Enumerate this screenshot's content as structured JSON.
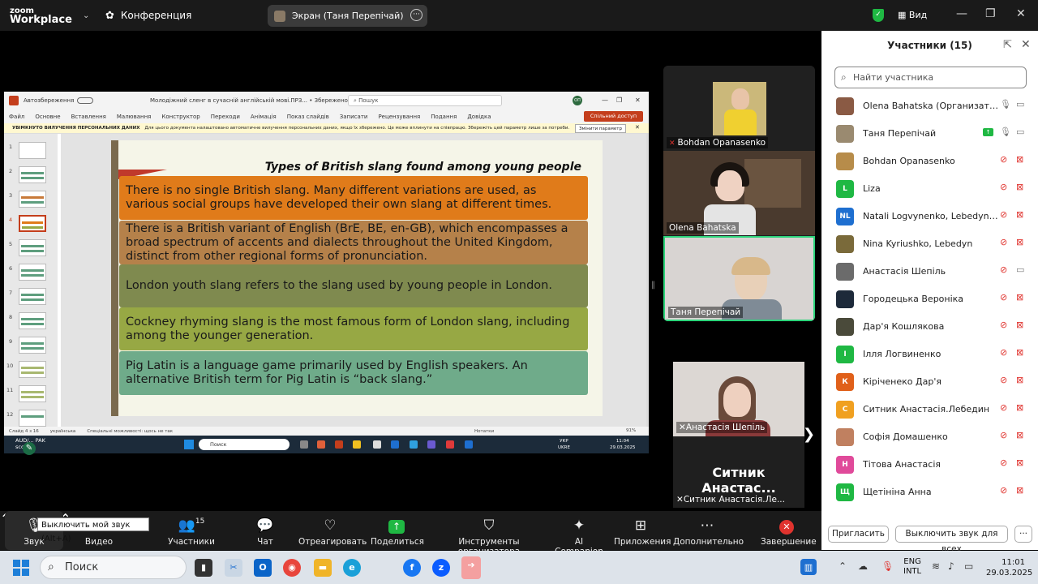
{
  "app": {
    "logo_line1": "zoom",
    "logo_line2": "Workplace",
    "conference_label": "Конференция",
    "share_pill": "Экран (Таня Перепічай)",
    "view_label": "Вид",
    "brand_green": "#1fb843",
    "end_red": "#e0332e"
  },
  "ppt": {
    "autosave": "Автозбереження",
    "filename": "Молодіжний сленг в сучасній англійській мові.ПРЗ... • Збережено у цей ПК",
    "search": "Пошук",
    "user_initials": "ОП",
    "menu": [
      "Файл",
      "Основне",
      "Вставлення",
      "Малювання",
      "Конструктор",
      "Переходи",
      "Анімація",
      "Показ слайдів",
      "Записати",
      "Рецензування",
      "Подання",
      "Довідка"
    ],
    "share_button": "Спільний доступ",
    "notice_bold": "УВІМКНУТО ВИЛУЧЕННЯ ПЕРСОНАЛЬНИХ ДАНИХ",
    "notice_text": "Для цього документа налаштовано автоматичне вилучення персональних даних, якщо їх збережено. Це може вплинути на співпрацю. Збережіть цей параметр лише за потреби.",
    "notice_button": "Змінити параметр",
    "slide_numbers": [
      "1",
      "2",
      "3",
      "4",
      "5",
      "6",
      "7",
      "8",
      "9",
      "10",
      "11",
      "12"
    ],
    "selected_slide": "4",
    "slide": {
      "title": "Types of British slang found among young people",
      "boxes": [
        {
          "text": "There is no single British slang. Many different variations are used, as various social groups have developed their own slang at different times.",
          "color": "#e07b1a"
        },
        {
          "text": "There is a British variant of English (BrE, BE, en-GB), which encompasses a broad spectrum of accents and dialects throughout the United Kingdom, distinct from other regional forms of pronunciation.",
          "color": "#b5814a"
        },
        {
          "text": "London youth slang refers to the slang used by young people in London.",
          "color": "#7f8a4f"
        },
        {
          "text": "Cockney rhyming slang is the most famous form of London slang, including among the younger generation.",
          "color": "#97a844"
        },
        {
          "text": "Pig Latin is a language game primarily used by English speakers. An alternative British term for Pig Latin is “back slang.”",
          "color": "#6fab8a"
        }
      ]
    },
    "status_slide": "Слайд 4 з 16",
    "status_lang": "українська",
    "status_access": "Спеціальні можливості: щось не так",
    "status_notes": "Нотатки",
    "status_zoom": "91%",
    "taskbar_game": "AUD/... PAK",
    "taskbar_game2": "score",
    "taskbar_search": "Поиск",
    "taskbar_lang1": "УКР",
    "taskbar_lang2": "UKRE",
    "taskbar_time": "11:04",
    "taskbar_date": "29.03.2025"
  },
  "gallery": {
    "tiles": [
      {
        "name": "Bohdan Opanasenko",
        "muted": true
      },
      {
        "name": "Olena Bahatska",
        "muted": false
      },
      {
        "name": "Таня Перепічай",
        "muted": false
      }
    ],
    "big_tile": {
      "video_name": "Анастасія Шепіль",
      "display_text": "Ситник  Анастас...",
      "name": "Ситник Анастасія.Ле..."
    }
  },
  "participants": {
    "title": "Участники (15)",
    "search_placeholder": "Найти участника",
    "list": [
      {
        "name": "Olena Bahatska (Организатор, я)",
        "initials": "",
        "color": "#8a5a44",
        "mic": "on",
        "cam": "on",
        "sharing": false
      },
      {
        "name": "Таня Перепічай",
        "initials": "",
        "color": "#9a8a70",
        "mic": "on",
        "cam": "on",
        "sharing": true
      },
      {
        "name": "Bohdan Opanasenko",
        "initials": "",
        "color": "#b78c4a",
        "mic": "off",
        "cam": "off",
        "sharing": false
      },
      {
        "name": "Liza",
        "initials": "L",
        "color": "#1fb843",
        "mic": "off",
        "cam": "off",
        "sharing": false
      },
      {
        "name": "Natali Logvynenko, Lebedyn, Sum...",
        "initials": "NL",
        "color": "#1e6fd0",
        "mic": "off",
        "cam": "off",
        "sharing": false
      },
      {
        "name": "Nina Kyriushko, Lebedyn",
        "initials": "",
        "color": "#7a6a3a",
        "mic": "off",
        "cam": "off",
        "sharing": false
      },
      {
        "name": "Анастасія Шепіль",
        "initials": "",
        "color": "#6b6b6b",
        "mic": "off",
        "cam": "on",
        "sharing": false
      },
      {
        "name": "Городецька Вероніка",
        "initials": "",
        "color": "#1d2a3a",
        "mic": "off",
        "cam": "off",
        "sharing": false
      },
      {
        "name": "Дар'я Кошлякова",
        "initials": "",
        "color": "#4a4a3a",
        "mic": "off",
        "cam": "off",
        "sharing": false
      },
      {
        "name": "Ілля Логвиненко",
        "initials": "І",
        "color": "#1fb843",
        "mic": "off",
        "cam": "off",
        "sharing": false
      },
      {
        "name": "Кіріченеко Дар'я",
        "initials": "К",
        "color": "#e0601a",
        "mic": "off",
        "cam": "off",
        "sharing": false
      },
      {
        "name": "Ситник Анастасія.Лебедин",
        "initials": "С",
        "color": "#f0a020",
        "mic": "off",
        "cam": "off",
        "sharing": false
      },
      {
        "name": "Софія Домашенко",
        "initials": "",
        "color": "#c08060",
        "mic": "off",
        "cam": "off",
        "sharing": false
      },
      {
        "name": "Тітова Анастасія",
        "initials": "Н",
        "color": "#e04a9a",
        "mic": "off",
        "cam": "off",
        "sharing": false
      },
      {
        "name": "Щетініна Анна",
        "initials": "Щ",
        "color": "#1fb843",
        "mic": "off",
        "cam": "off",
        "sharing": false
      }
    ],
    "invite_button": "Пригласить",
    "mute_all_button": "Выключить звук для всех"
  },
  "toolbar": {
    "tooltip": "Выключить мой звук (Alt+A)",
    "audio": "Звук",
    "video": "Видео",
    "participants": "Участники",
    "participants_count": "15",
    "chat": "Чат",
    "react": "Отреагировать",
    "share": "Поделиться",
    "host_tools": "Инструменты организатора",
    "ai": "AI Companion",
    "apps": "Приложения",
    "more": "Дополнительно",
    "end": "Завершение"
  },
  "taskbar": {
    "search": "Поиск",
    "lang1": "ENG",
    "lang2": "INTL",
    "time": "11:01",
    "date": "29.03.2025"
  }
}
